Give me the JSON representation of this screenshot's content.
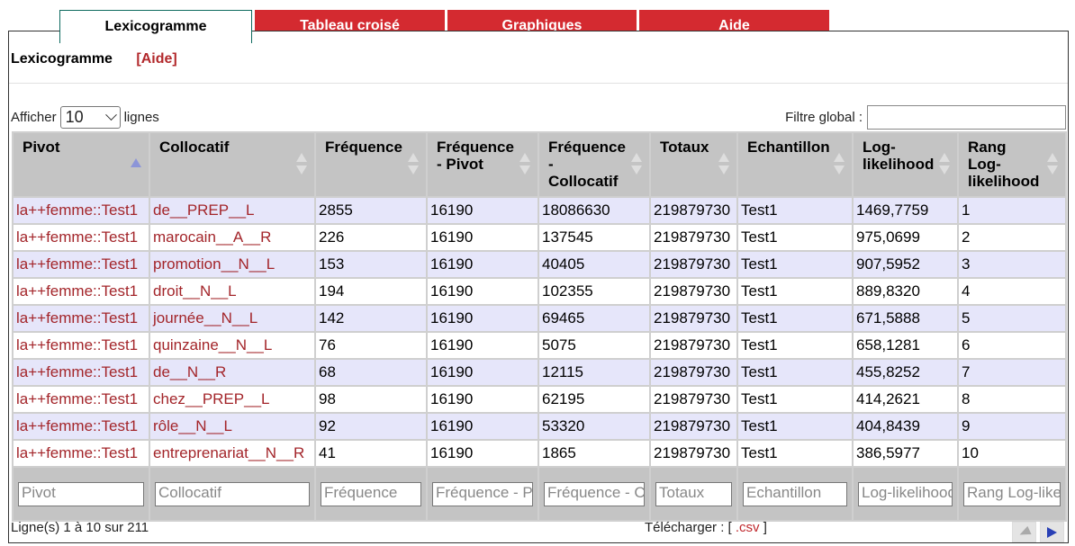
{
  "tabs": [
    {
      "label": "Lexicogramme",
      "active": true
    },
    {
      "label": "Tableau croisé",
      "active": false
    },
    {
      "label": "Graphiques",
      "active": false
    },
    {
      "label": "Aide",
      "active": false
    }
  ],
  "header": {
    "title": "Lexicogramme",
    "help": "[Aide]"
  },
  "length": {
    "prefix": "Afficher",
    "value": "10",
    "suffix": "lignes"
  },
  "filter": {
    "label": "Filtre global :"
  },
  "columns": [
    "Pivot",
    "Collocatif",
    "Fréquence",
    "Fréquence - Pivot",
    "Fréquence - Collocatif",
    "Totaux",
    "Echantillon",
    "Log-likelihood",
    "Rang Log-likelihood"
  ],
  "rows": [
    [
      "la++femme::Test1",
      "de__PREP__L",
      "2855",
      "16190",
      "18086630",
      "219879730",
      "Test1",
      "1469,7759",
      "1"
    ],
    [
      "la++femme::Test1",
      "marocain__A__R",
      "226",
      "16190",
      "137545",
      "219879730",
      "Test1",
      "975,0699",
      "2"
    ],
    [
      "la++femme::Test1",
      "promotion__N__L",
      "153",
      "16190",
      "40405",
      "219879730",
      "Test1",
      "907,5952",
      "3"
    ],
    [
      "la++femme::Test1",
      "droit__N__L",
      "194",
      "16190",
      "102355",
      "219879730",
      "Test1",
      "889,8320",
      "4"
    ],
    [
      "la++femme::Test1",
      "journée__N__L",
      "142",
      "16190",
      "69465",
      "219879730",
      "Test1",
      "671,5888",
      "5"
    ],
    [
      "la++femme::Test1",
      "quinzaine__N__L",
      "76",
      "16190",
      "5075",
      "219879730",
      "Test1",
      "658,1281",
      "6"
    ],
    [
      "la++femme::Test1",
      "de__N__R",
      "68",
      "16190",
      "12115",
      "219879730",
      "Test1",
      "455,8252",
      "7"
    ],
    [
      "la++femme::Test1",
      "chez__PREP__L",
      "98",
      "16190",
      "62195",
      "219879730",
      "Test1",
      "414,2621",
      "8"
    ],
    [
      "la++femme::Test1",
      "rôle__N__L",
      "92",
      "16190",
      "53320",
      "219879730",
      "Test1",
      "404,8439",
      "9"
    ],
    [
      "la++femme::Test1",
      "entreprenariat__N__R",
      "41",
      "16190",
      "1865",
      "219879730",
      "Test1",
      "386,5977",
      "10"
    ]
  ],
  "column_filters": [
    "Pivot",
    "Collocatif",
    "Fréquence",
    "Fréquence - Pivot",
    "Fréquence - Collocatif",
    "Totaux",
    "Echantillon",
    "Log-likelihood",
    "Rang Log-likelihood"
  ],
  "footer": {
    "info": "Ligne(s) 1 à 10 sur 211",
    "download_prefix": "Télécharger : [",
    "download_link": " .csv",
    "download_suffix": " ]"
  },
  "colors": {
    "tab_inactive": "#d42a30",
    "link": "#a3252a",
    "odd_row": "#e6e6fa",
    "header": "#c4c4c4"
  }
}
